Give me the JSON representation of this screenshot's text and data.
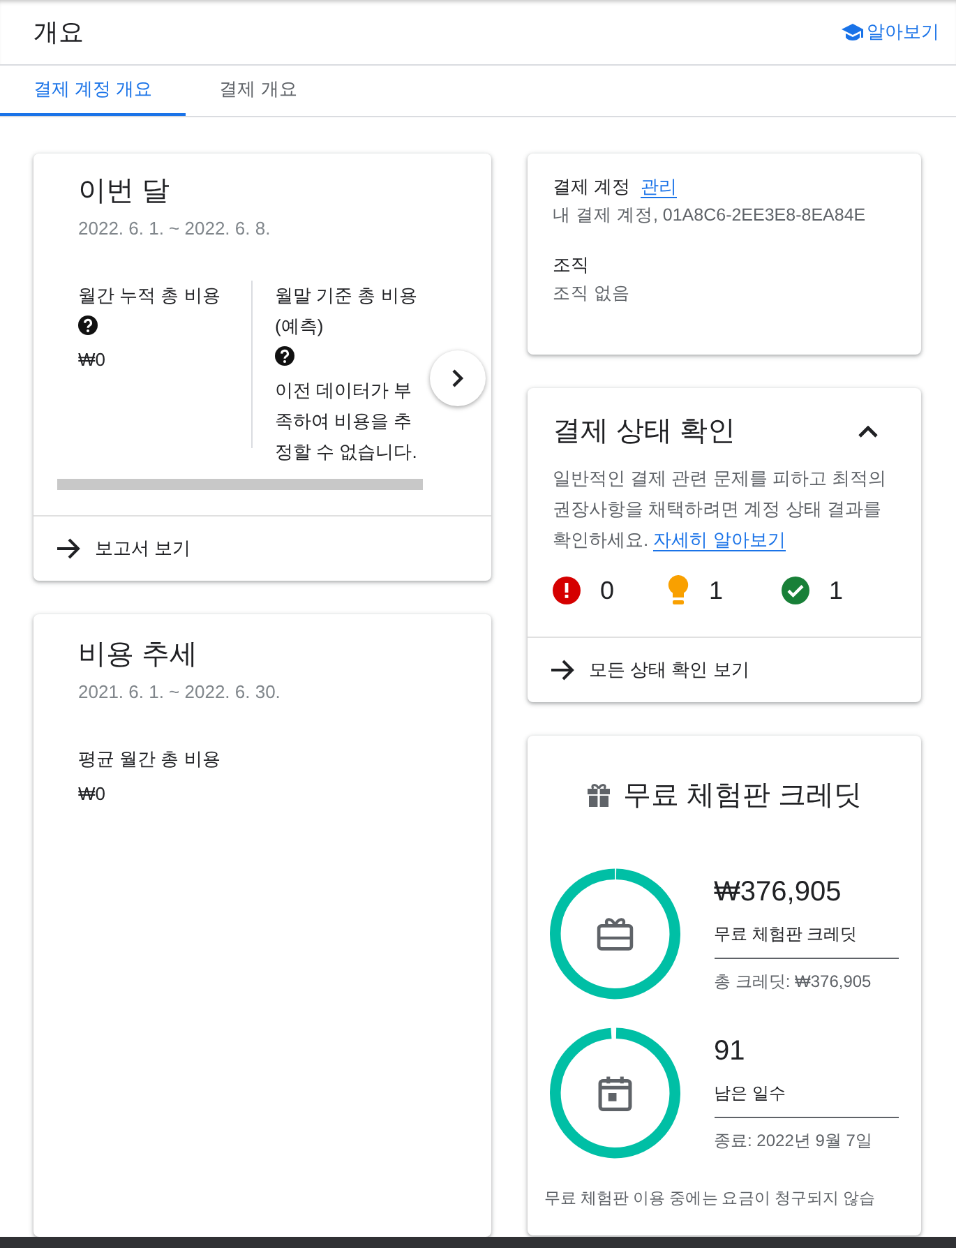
{
  "header": {
    "title": "개요",
    "learn_link": "알아보기"
  },
  "tabs": [
    {
      "label": "결제 계정 개요",
      "selected": true
    },
    {
      "label": "결제 개요",
      "selected": false
    }
  ],
  "this_month": {
    "title": "이번 달",
    "date_range": "2022. 6. 1. ~ 2022. 6. 8.",
    "metrics": [
      {
        "label": "월간 누적 총 비용",
        "value": "₩0"
      },
      {
        "label": "월말 기준 총 비용 (예측)",
        "value": "이전 데이터가 부족하여 비용을 추정할 수 없습니다."
      }
    ],
    "footer_link": "보고서 보기"
  },
  "cost_trend": {
    "title": "비용 추세",
    "date_range": "2021. 6. 1. ~ 2022. 6. 30.",
    "metric_label": "평균 월간 총 비용",
    "metric_value": "₩0"
  },
  "account": {
    "label": "결제 계정",
    "manage_link": "관리",
    "account_name": "내 결제 계정, 01A8C6-2EE3E8-8EA84E",
    "org_label": "조직",
    "org_value": "조직 없음"
  },
  "health": {
    "title": "결제 상태 확인",
    "expanded": true,
    "description": "일반적인 결제 관련 문제를 피하고 최적의 권장사항을 채택하려면 계정 상태 결과를 확인하세요.",
    "learn_more": "자세히 알아보기",
    "counts": [
      {
        "kind": "error",
        "count": "0"
      },
      {
        "kind": "suggestion",
        "count": "1"
      },
      {
        "kind": "ok",
        "count": "1"
      }
    ],
    "footer_link": "모든 상태 확인 보기"
  },
  "credits": {
    "title": "무료 체험판 크레딧",
    "meters": [
      {
        "kind": "credit",
        "value": "₩376,905",
        "label": "무료 체험판 크레딧",
        "detail": "총 크레딧: ₩376,905",
        "level": 1
      },
      {
        "kind": "days",
        "value": "91",
        "label": "남은 일수",
        "detail": "종료: 2022년 9월 7일",
        "level": 0.99
      }
    ],
    "note": "무료 체험판 이용 중에는 요금이 청구되지 않습"
  }
}
